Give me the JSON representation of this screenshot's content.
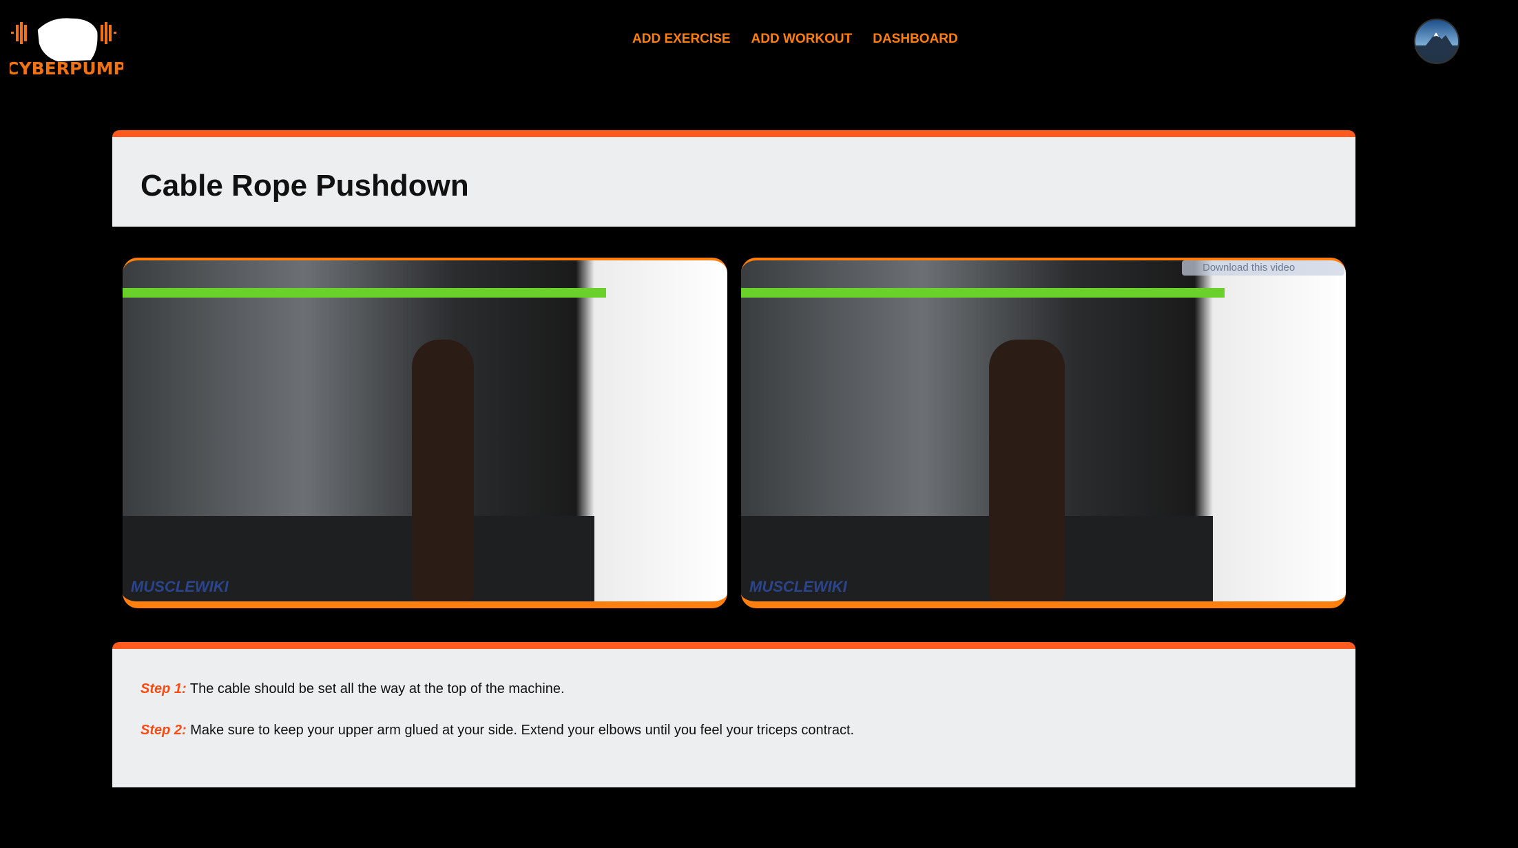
{
  "header": {
    "logo_text": "CYBERPUMP",
    "nav": [
      "ADD EXERCISE",
      "ADD WORKOUT",
      "DASHBOARD"
    ]
  },
  "exercise": {
    "title": "Cable Rope Pushdown"
  },
  "videos": [
    {
      "watermark": "MUSCLEWIKI"
    },
    {
      "watermark": "MUSCLEWIKI",
      "download_label": "Download this video"
    }
  ],
  "steps": [
    {
      "label": "Step 1:",
      "text": "The cable should be set all the way at the top of the machine."
    },
    {
      "label": "Step 2:",
      "text": "Make sure to keep your upper arm glued at your side. Extend your elbows until you feel your triceps contract."
    }
  ],
  "colors": {
    "accent": "#ff7f0e",
    "card_border": "#ff5a1f",
    "step_label": "#ff4a12"
  }
}
